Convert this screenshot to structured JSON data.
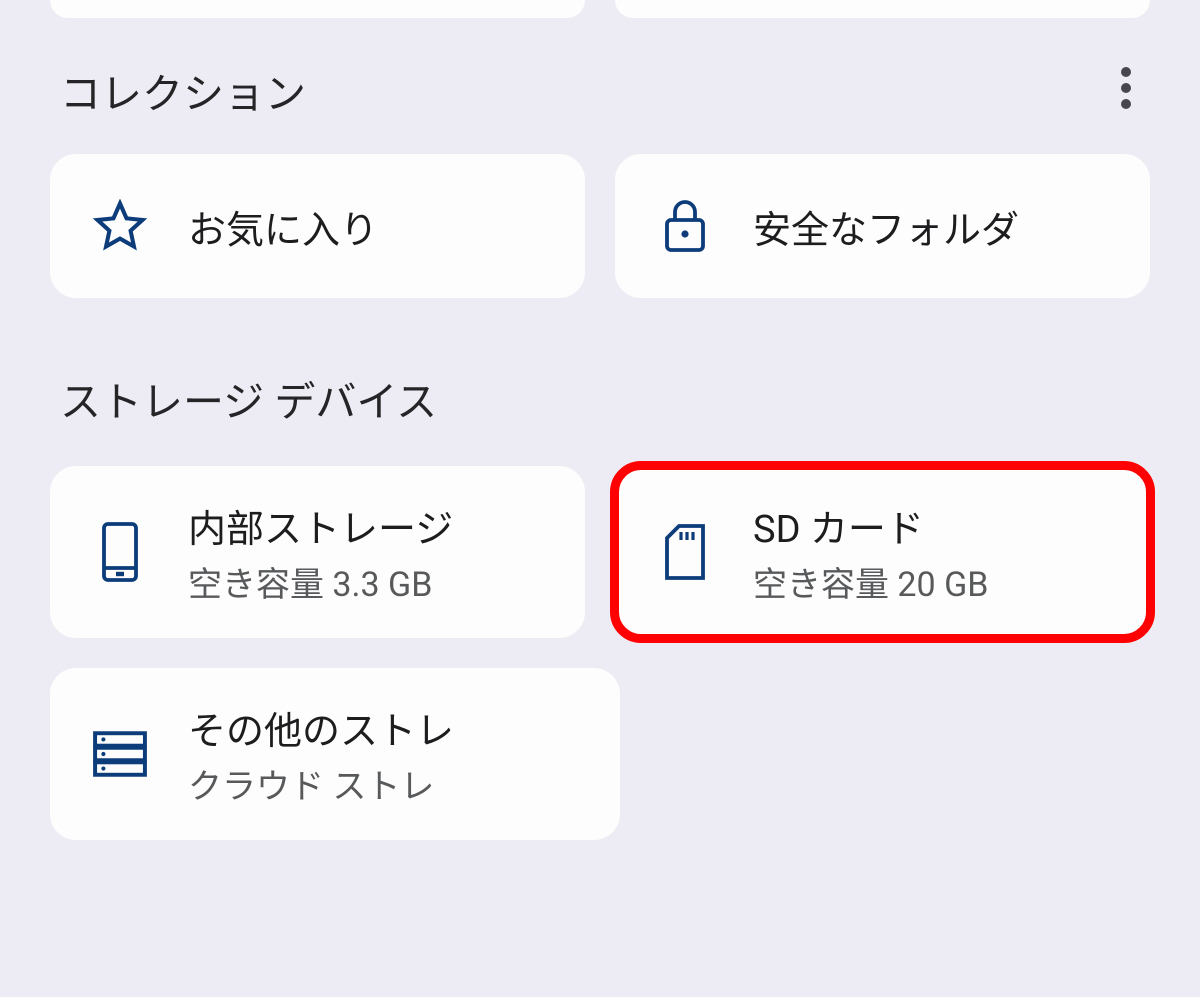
{
  "collections": {
    "title": "コレクション",
    "items": [
      {
        "label": "お気に入り",
        "icon": "star"
      },
      {
        "label": "安全なフォルダ",
        "icon": "lock"
      }
    ]
  },
  "storage": {
    "title": "ストレージ デバイス",
    "items": [
      {
        "title": "内部ストレージ",
        "subtitle": "空き容量 3.3 GB",
        "icon": "phone",
        "highlighted": false
      },
      {
        "title": "SD カード",
        "subtitle": "空き容量 20 GB",
        "icon": "sdcard",
        "highlighted": true
      },
      {
        "title": "その他のストレ",
        "subtitle": "クラウド ストレ",
        "icon": "server",
        "highlighted": false
      }
    ]
  },
  "colors": {
    "iconBlue": "#0d3c7a",
    "highlightRed": "#ff0103"
  }
}
